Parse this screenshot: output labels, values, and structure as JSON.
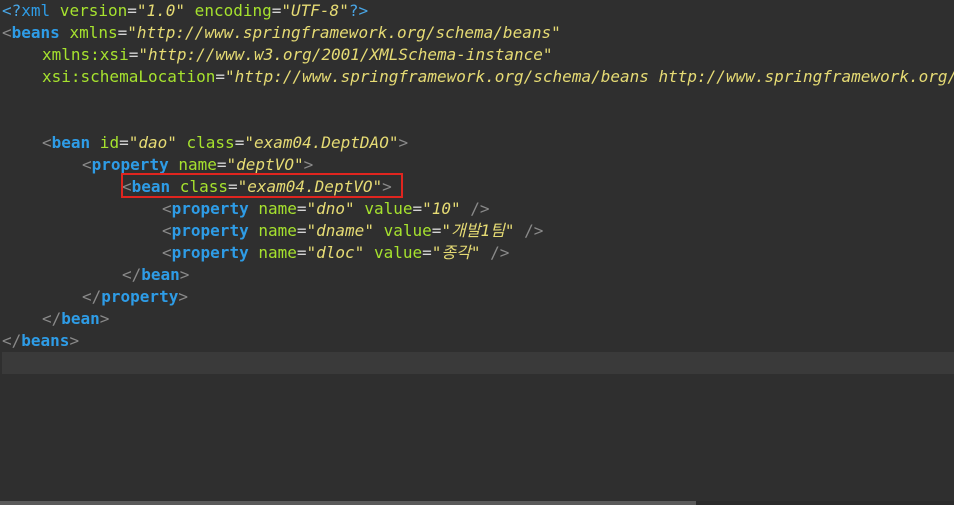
{
  "editor": {
    "lines": [
      {
        "indent": 0,
        "tokens": [
          {
            "t": "<?",
            "c": "pi"
          },
          {
            "t": "xml",
            "c": "tagpi"
          },
          {
            "t": " version",
            "c": "attr"
          },
          {
            "t": "=",
            "c": "eq"
          },
          {
            "t": "\"1.0\"",
            "c": "val"
          },
          {
            "t": " encoding",
            "c": "attr"
          },
          {
            "t": "=",
            "c": "eq"
          },
          {
            "t": "\"UTF-8\"",
            "c": "val"
          },
          {
            "t": "?>",
            "c": "pi"
          }
        ]
      },
      {
        "indent": 0,
        "tokens": [
          {
            "t": "<",
            "c": "br"
          },
          {
            "t": "beans",
            "c": "tag"
          },
          {
            "t": " xmlns",
            "c": "attr"
          },
          {
            "t": "=",
            "c": "eq"
          },
          {
            "t": "\"http://www.springframework.org/schema/beans\"",
            "c": "val"
          }
        ]
      },
      {
        "indent": 1,
        "tokens": [
          {
            "t": "xmlns:xsi",
            "c": "attr"
          },
          {
            "t": "=",
            "c": "eq"
          },
          {
            "t": "\"http://www.w3.org/2001/XMLSchema-instance\"",
            "c": "val"
          }
        ]
      },
      {
        "indent": 1,
        "tokens": [
          {
            "t": "xsi:schemaLocation",
            "c": "attr"
          },
          {
            "t": "=",
            "c": "eq"
          },
          {
            "t": "\"http://www.springframework.org/schema/beans http://www.springframework.org/schema/beans/spring-beans.xsd\"",
            "c": "val"
          }
        ]
      },
      {
        "indent": 0,
        "tokens": []
      },
      {
        "indent": 0,
        "tokens": []
      },
      {
        "indent": 1,
        "tokens": [
          {
            "t": "<",
            "c": "br"
          },
          {
            "t": "bean",
            "c": "tag"
          },
          {
            "t": " id",
            "c": "attr"
          },
          {
            "t": "=",
            "c": "eq"
          },
          {
            "t": "\"dao\"",
            "c": "val"
          },
          {
            "t": " class",
            "c": "attr"
          },
          {
            "t": "=",
            "c": "eq"
          },
          {
            "t": "\"exam04.DeptDAO\"",
            "c": "val"
          },
          {
            "t": ">",
            "c": "br"
          }
        ]
      },
      {
        "indent": 2,
        "tokens": [
          {
            "t": "<",
            "c": "br"
          },
          {
            "t": "property",
            "c": "tag"
          },
          {
            "t": " name",
            "c": "attr"
          },
          {
            "t": "=",
            "c": "eq"
          },
          {
            "t": "\"deptVO\"",
            "c": "val"
          },
          {
            "t": ">",
            "c": "br"
          }
        ]
      },
      {
        "indent": 3,
        "tokens": [
          {
            "t": "<",
            "c": "br"
          },
          {
            "t": "bean",
            "c": "tag"
          },
          {
            "t": " class",
            "c": "attr"
          },
          {
            "t": "=",
            "c": "eq"
          },
          {
            "t": "\"exam04.DeptVO\"",
            "c": "val"
          },
          {
            "t": ">",
            "c": "br"
          }
        ]
      },
      {
        "indent": 4,
        "tokens": [
          {
            "t": "<",
            "c": "br"
          },
          {
            "t": "property",
            "c": "tag"
          },
          {
            "t": " name",
            "c": "attr"
          },
          {
            "t": "=",
            "c": "eq"
          },
          {
            "t": "\"dno\"",
            "c": "val"
          },
          {
            "t": " value",
            "c": "attr"
          },
          {
            "t": "=",
            "c": "eq"
          },
          {
            "t": "\"10\"",
            "c": "val"
          },
          {
            "t": " />",
            "c": "br"
          }
        ]
      },
      {
        "indent": 4,
        "tokens": [
          {
            "t": "<",
            "c": "br"
          },
          {
            "t": "property",
            "c": "tag"
          },
          {
            "t": " name",
            "c": "attr"
          },
          {
            "t": "=",
            "c": "eq"
          },
          {
            "t": "\"dname\"",
            "c": "val"
          },
          {
            "t": " value",
            "c": "attr"
          },
          {
            "t": "=",
            "c": "eq"
          },
          {
            "t": "\"개발1팀\"",
            "c": "val"
          },
          {
            "t": " />",
            "c": "br"
          }
        ]
      },
      {
        "indent": 4,
        "tokens": [
          {
            "t": "<",
            "c": "br"
          },
          {
            "t": "property",
            "c": "tag"
          },
          {
            "t": " name",
            "c": "attr"
          },
          {
            "t": "=",
            "c": "eq"
          },
          {
            "t": "\"dloc\"",
            "c": "val"
          },
          {
            "t": " value",
            "c": "attr"
          },
          {
            "t": "=",
            "c": "eq"
          },
          {
            "t": "\"종각\"",
            "c": "val"
          },
          {
            "t": " />",
            "c": "br"
          }
        ]
      },
      {
        "indent": 3,
        "tokens": [
          {
            "t": "</",
            "c": "br"
          },
          {
            "t": "bean",
            "c": "tag"
          },
          {
            "t": ">",
            "c": "br"
          }
        ]
      },
      {
        "indent": 2,
        "tokens": [
          {
            "t": "</",
            "c": "br"
          },
          {
            "t": "property",
            "c": "tag"
          },
          {
            "t": ">",
            "c": "br"
          }
        ]
      },
      {
        "indent": 1,
        "tokens": [
          {
            "t": "</",
            "c": "br"
          },
          {
            "t": "bean",
            "c": "tag"
          },
          {
            "t": ">",
            "c": "br"
          }
        ]
      },
      {
        "indent": 0,
        "tokens": [
          {
            "t": "</",
            "c": "br"
          },
          {
            "t": "beans",
            "c": "tag"
          },
          {
            "t": ">",
            "c": "br"
          }
        ]
      },
      {
        "indent": 0,
        "tokens": []
      }
    ],
    "highlighted_line_index": 8,
    "current_line_index": 16
  },
  "colors": {
    "background": "#2f2f2f",
    "tag": "#2e9ce6",
    "attribute": "#a6e22e",
    "value": "#e6db74",
    "bracket": "#8a8a8a",
    "highlight_border": "#e0251f"
  }
}
